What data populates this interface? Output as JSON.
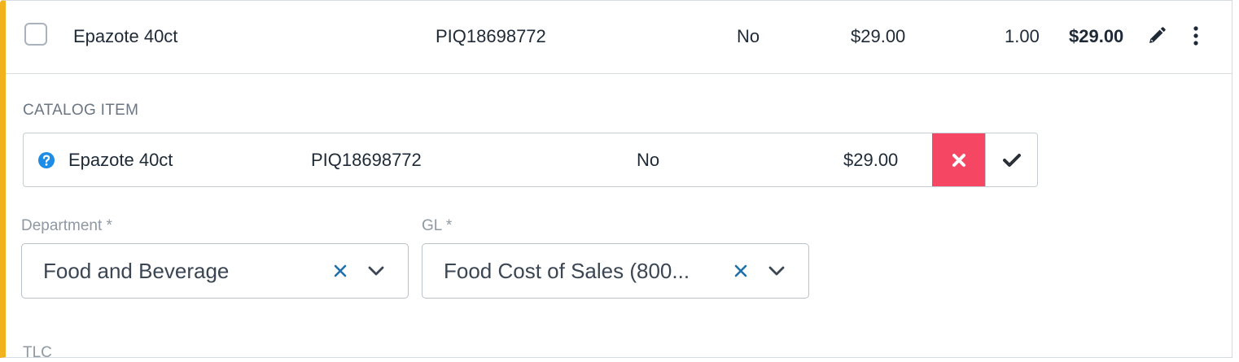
{
  "line_item": {
    "name": "Epazote 40ct",
    "sku": "PIQ18698772",
    "flag": "No",
    "unit_price": "$29.00",
    "quantity": "1.00",
    "total": "$29.00"
  },
  "catalog_section": {
    "label": "CATALOG ITEM",
    "item": {
      "name": "Epazote 40ct",
      "sku": "PIQ18698772",
      "flag": "No",
      "price": "$29.00"
    }
  },
  "department": {
    "label": "Department *",
    "value": "Food and Beverage"
  },
  "gl": {
    "label": "GL *",
    "value": "Food Cost of Sales (800..."
  },
  "next_field": {
    "label": "TLC"
  },
  "colors": {
    "accent_left_border": "#f2b21d",
    "reject_button": "#f54663",
    "help_icon": "#1c8ce6",
    "clear_icon": "#1f6fa8"
  },
  "icons": {
    "edit": "pencil-icon",
    "more": "kebab-menu-icon",
    "help": "question-circle-icon",
    "reject": "close-icon",
    "accept": "check-icon",
    "clear": "clear-icon",
    "dropdown": "chevron-down-icon"
  }
}
